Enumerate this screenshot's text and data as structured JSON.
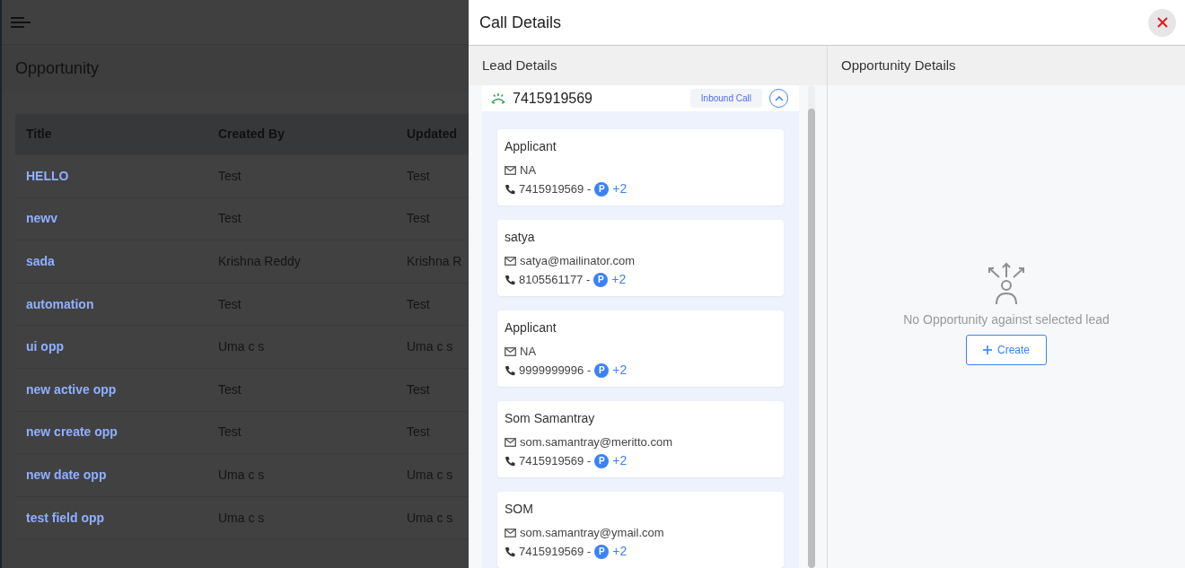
{
  "page": {
    "title": "Opportunity",
    "table": {
      "columns": [
        "Title",
        "Created By",
        "Updated"
      ],
      "rows": [
        [
          "HELLO",
          "Test",
          "Test"
        ],
        [
          "newv",
          "Test",
          "Test"
        ],
        [
          "sada",
          "Krishna Reddy",
          "Krishna R"
        ],
        [
          "automation",
          "Test",
          "Test"
        ],
        [
          "ui opp",
          "Uma c s",
          "Uma c s"
        ],
        [
          "new active opp",
          "Test",
          "Test"
        ],
        [
          "new create opp",
          "Test",
          "Test"
        ],
        [
          "new date opp",
          "Uma c s",
          "Uma c s"
        ],
        [
          "test field opp",
          "Uma c s",
          "Uma c s"
        ]
      ]
    }
  },
  "drawer": {
    "title": "Call Details",
    "lead_panel": {
      "title": "Lead Details",
      "call": {
        "number": "7415919569",
        "badge": "Inbound Call",
        "expanded": true
      },
      "leads": [
        {
          "name": "Applicant",
          "email": "NA",
          "phone": "7415919569 -",
          "tag": "P",
          "extra": "+2"
        },
        {
          "name": "satya",
          "email": "satya@mailinator.com",
          "phone": "8105561177 -",
          "tag": "P",
          "extra": "+2"
        },
        {
          "name": "Applicant",
          "email": "NA",
          "phone": "9999999996 -",
          "tag": "P",
          "extra": "+2"
        },
        {
          "name": "Som Samantray",
          "email": "som.samantray@meritto.com",
          "phone": "7415919569 -",
          "tag": "P",
          "extra": "+2"
        },
        {
          "name": "SOM",
          "email": "som.samantray@ymail.com",
          "phone": "7415919569 -",
          "tag": "P",
          "extra": "+2"
        }
      ]
    },
    "opportunity_panel": {
      "title": "Opportunity Details",
      "empty_message": "No Opportunity against selected lead",
      "create_button": "Create"
    }
  }
}
